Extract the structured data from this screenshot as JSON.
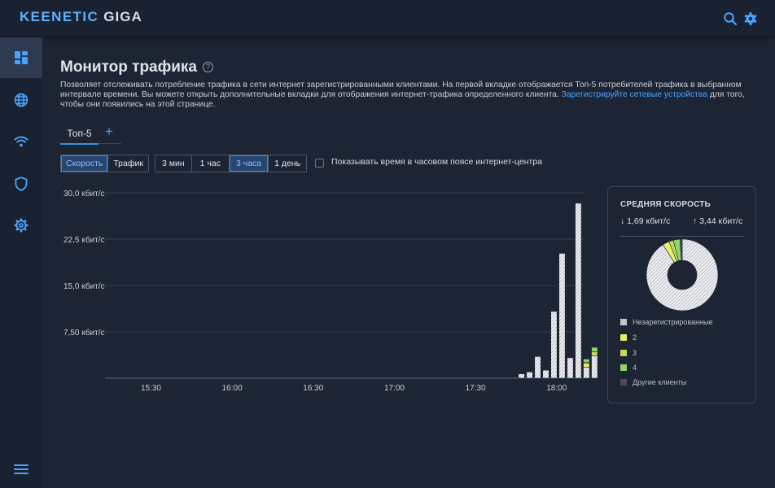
{
  "header": {
    "brand": "KEENETIC",
    "model": "GIGA",
    "icons": [
      "search-icon",
      "gear-icon"
    ]
  },
  "sidebar": {
    "items": [
      {
        "name": "dashboard",
        "icon": "dashboard-icon",
        "active": true
      },
      {
        "name": "internet",
        "icon": "globe-icon"
      },
      {
        "name": "wifi",
        "icon": "wifi-icon"
      },
      {
        "name": "security",
        "icon": "shield-icon"
      },
      {
        "name": "settings",
        "icon": "gear-icon"
      }
    ],
    "menu_icon": "hamburger-icon"
  },
  "page": {
    "title": "Монитор трафика",
    "description_1": "Позволяет отслеживать потребление трафика в сети интернет зарегистрированными клиентами. На первой вкладке отображается Топ-5 потребителей трафика в выбранном интервале времени. Вы можете открыть дополнительные вкладки для отображения интернет-трафика определенного клиента. ",
    "description_link": "Зарегистрируйте сетевые устройства",
    "description_2": " для того, чтобы они появились на этой странице.",
    "tab": "Топ-5",
    "add_tab": "+"
  },
  "controls": {
    "metric": [
      "Скорость",
      "Трафик"
    ],
    "metric_selected": "Скорость",
    "range": [
      "3 мин",
      "1 час",
      "3 часа",
      "1 день"
    ],
    "range_selected": "3 часа",
    "timezone_checkbox": {
      "label": "Показывать время в часовом поясе интернет-центра",
      "checked": false
    }
  },
  "chart_data": {
    "type": "bar",
    "stacked": true,
    "y_ticks": [
      "30,0 кбит/с",
      "22,5 кбит/с",
      "15,0 кбит/с",
      "7,50 кбит/с"
    ],
    "ylim": [
      0,
      30
    ],
    "x_ticks": [
      "15:30",
      "16:00",
      "16:30",
      "17:00",
      "17:30",
      "18:00"
    ],
    "x_tick_minutes": [
      0,
      30,
      60,
      90,
      120,
      150
    ],
    "x_range_minutes": [
      -17,
      160
    ],
    "bar_minutes": [
      137,
      140,
      143,
      146,
      149,
      152,
      155,
      158,
      161,
      164,
      167,
      170
    ],
    "series": [
      {
        "name": "Незарегистрированные",
        "color": "hatched",
        "values": [
          0.7,
          1.0,
          3.5,
          1.3,
          10.8,
          20.2,
          3.3,
          28.3,
          1.8,
          3.6,
          0.9,
          0.9
        ]
      },
      {
        "name": "2",
        "color": "#e8f066",
        "values": [
          0,
          0,
          0,
          0,
          0,
          0,
          0,
          0,
          0.6,
          0,
          1.1,
          0.4
        ]
      },
      {
        "name": "3",
        "color": "#c3db5a",
        "values": [
          0,
          0,
          0,
          0,
          0,
          0,
          0,
          0,
          0.2,
          0.7,
          0.5,
          0.7
        ]
      },
      {
        "name": "4",
        "color": "#8fd66a",
        "values": [
          0,
          0,
          0,
          0,
          0,
          0,
          0,
          0,
          0.5,
          0.7,
          0.4,
          0.9
        ]
      }
    ],
    "grid": true
  },
  "summary": {
    "title": "СРЕДНЯЯ СКОРОСТЬ",
    "down": "↓ 1,69 кбит/с",
    "up": "↑ 3,44 кбит/с",
    "pie": [
      {
        "name": "Незарегистрированные",
        "value": 91,
        "color": "hatched"
      },
      {
        "name": "2",
        "value": 3,
        "color": "#e8f066"
      },
      {
        "name": "3",
        "value": 2,
        "color": "#c3db5a"
      },
      {
        "name": "4",
        "value": 3,
        "color": "#8fd66a"
      },
      {
        "name": "Другие клиенты",
        "value": 1,
        "color": "#4a4f57"
      }
    ],
    "legend": [
      {
        "label": "Незарегистрированные",
        "color": "#cfd3d8"
      },
      {
        "label": "2",
        "color": "#e8f066"
      },
      {
        "label": "3",
        "color": "#c3db5a"
      },
      {
        "label": "4",
        "color": "#8fd66a"
      },
      {
        "label": "Другие клиенты",
        "color": "#4a4f57"
      }
    ]
  }
}
